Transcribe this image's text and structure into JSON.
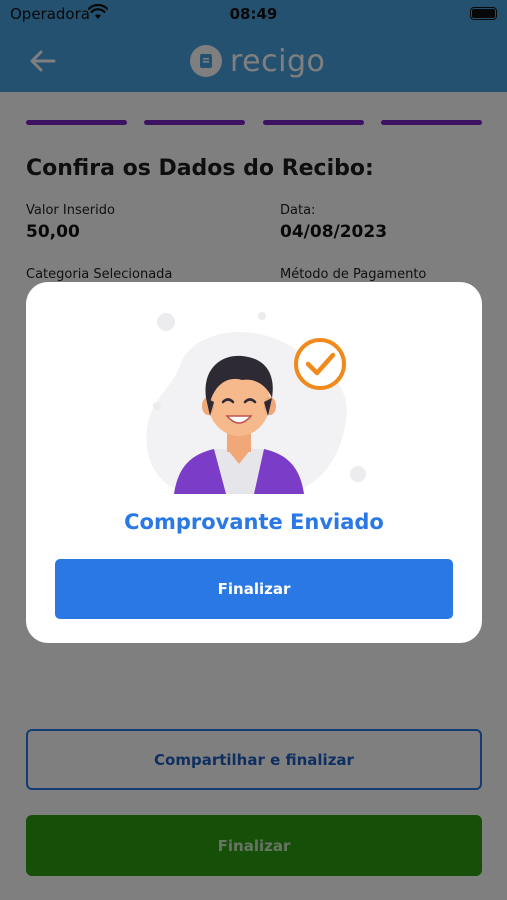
{
  "status_bar": {
    "carrier": "Operadora",
    "time": "08:49"
  },
  "header": {
    "logo_text": "recigo"
  },
  "steps": {
    "count": 4,
    "color": "#7b25c6"
  },
  "page": {
    "title": "Confira os Dados do Recibo:",
    "fields": {
      "valor_label": "Valor Inserido",
      "valor_value": "50,00",
      "data_label": "Data:",
      "data_value": "04/08/2023",
      "categoria_label": "Categoria Selecionada",
      "metodo_label": "Método de Pagamento"
    }
  },
  "actions": {
    "share_label": "Compartilhar e finalizar",
    "finish_label": "Finalizar"
  },
  "modal": {
    "title": "Comprovante Enviado",
    "button_label": "Finalizar"
  },
  "colors": {
    "header": "#4aa3e0",
    "primary": "#2a78e4",
    "success": "#2a9e10",
    "check": "#f08a1c"
  }
}
